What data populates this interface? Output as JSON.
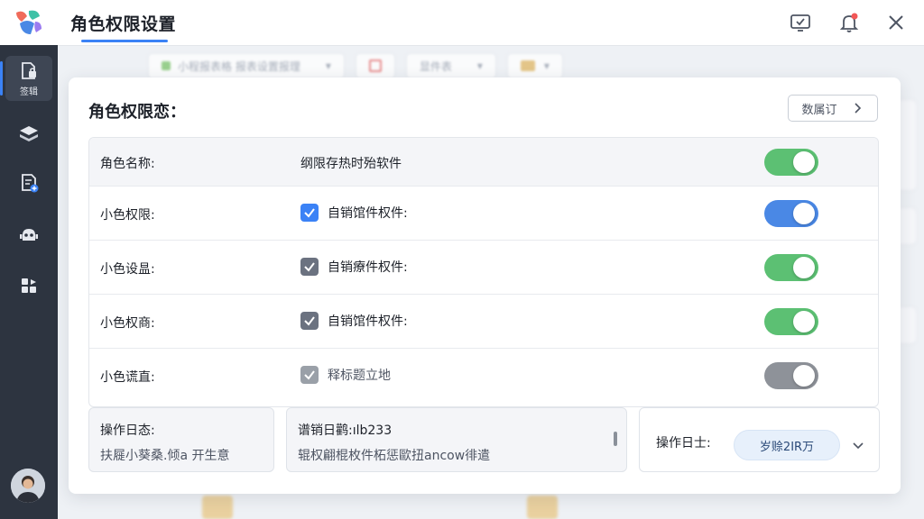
{
  "header": {
    "title": "角色权限设置",
    "icons": [
      "screen-check-icon",
      "bell-icon",
      "close-icon"
    ]
  },
  "sidebar": {
    "items": [
      {
        "icon": "document-lock-icon",
        "label": "签辑"
      },
      {
        "icon": "layers-icon"
      },
      {
        "icon": "document-add-icon"
      },
      {
        "icon": "robot-icon"
      },
      {
        "icon": "apps-icon"
      }
    ]
  },
  "background": {
    "toolbar_text": [
      "小程报表格 报表设置报理",
      "显件表"
    ]
  },
  "panel": {
    "title": "角色权限恋：",
    "edit_button_label": "数属订"
  },
  "table": {
    "header": {
      "name": "角色名称:",
      "permission": "纲限存热时殆软件"
    },
    "rows": [
      {
        "name": "小色权限:",
        "permission": "自销馆件权件:",
        "checked": true
      },
      {
        "name": "小色设昷:",
        "permission": "自销療件权件:",
        "checked": true
      },
      {
        "name": "小色权商:",
        "permission": "自销馆件权件:",
        "checked": true
      },
      {
        "name": "小色谎直:",
        "permission": "释标题立地",
        "checked": true
      }
    ]
  },
  "bottom": {
    "card1": {
      "title": "操作日态:",
      "subtitle": "扶屣小葵桑.倾a 开生意"
    },
    "card2": {
      "title": "谱销日鹳:ılb233",
      "subtitle": "辊权翩棍枚件柘惩歐扭ancow徘遣"
    },
    "card3": {
      "title": "操作日士:",
      "select_value": "岁赊2IR万"
    }
  },
  "colors": {
    "accent": "#3b82f6",
    "toggle_green": "#5cc073",
    "toggle_blue": "#4a88e5",
    "toggle_gray": "#8e9299",
    "checkbox_blue": "#3b82f6",
    "checkbox_gray": "#6b7280"
  }
}
